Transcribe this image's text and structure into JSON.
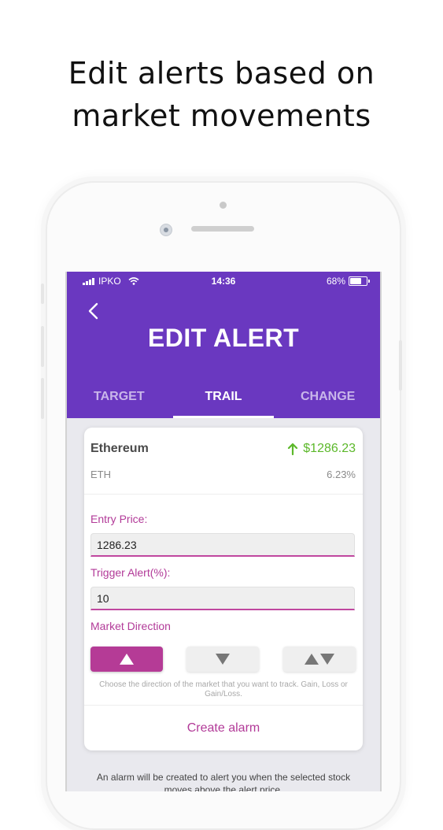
{
  "headline": {
    "line1": "Edit alerts based on",
    "line2": "market movements"
  },
  "status_bar": {
    "carrier": "IPKO",
    "time": "14:36",
    "battery": "68%"
  },
  "header": {
    "title": "EDIT ALERT",
    "back_icon": "chevron-left-icon"
  },
  "tabs": [
    {
      "label": "TARGET",
      "active": false
    },
    {
      "label": "TRAIL",
      "active": true
    },
    {
      "label": "CHANGE",
      "active": false
    }
  ],
  "asset": {
    "name": "Ethereum",
    "price": "$1286.23",
    "price_icon": "arrow-up-icon",
    "ticker": "ETH",
    "change": "6.23%"
  },
  "form": {
    "entry_price_label": "Entry Price:",
    "entry_price_value": "1286.23",
    "trigger_label": "Trigger Alert(%):",
    "trigger_value": "10",
    "direction_label": "Market Direction",
    "directions": [
      {
        "name": "gain",
        "icon": "triangle-up-icon",
        "selected": true
      },
      {
        "name": "loss",
        "icon": "triangle-down-icon",
        "selected": false
      },
      {
        "name": "gain-or-loss",
        "icon": "triangle-up-down-icon",
        "selected": false
      }
    ],
    "help_text": "Choose the direction of the market that you want to track. Gain, Loss or Gain/Loss.",
    "create_button": "Create alarm"
  },
  "footer_note": "An alarm will be created to alert you when the selected stock moves above the alert price.",
  "colors": {
    "header": "#6a38c0",
    "accent": "#b53b96",
    "gain": "#5cb82a"
  }
}
